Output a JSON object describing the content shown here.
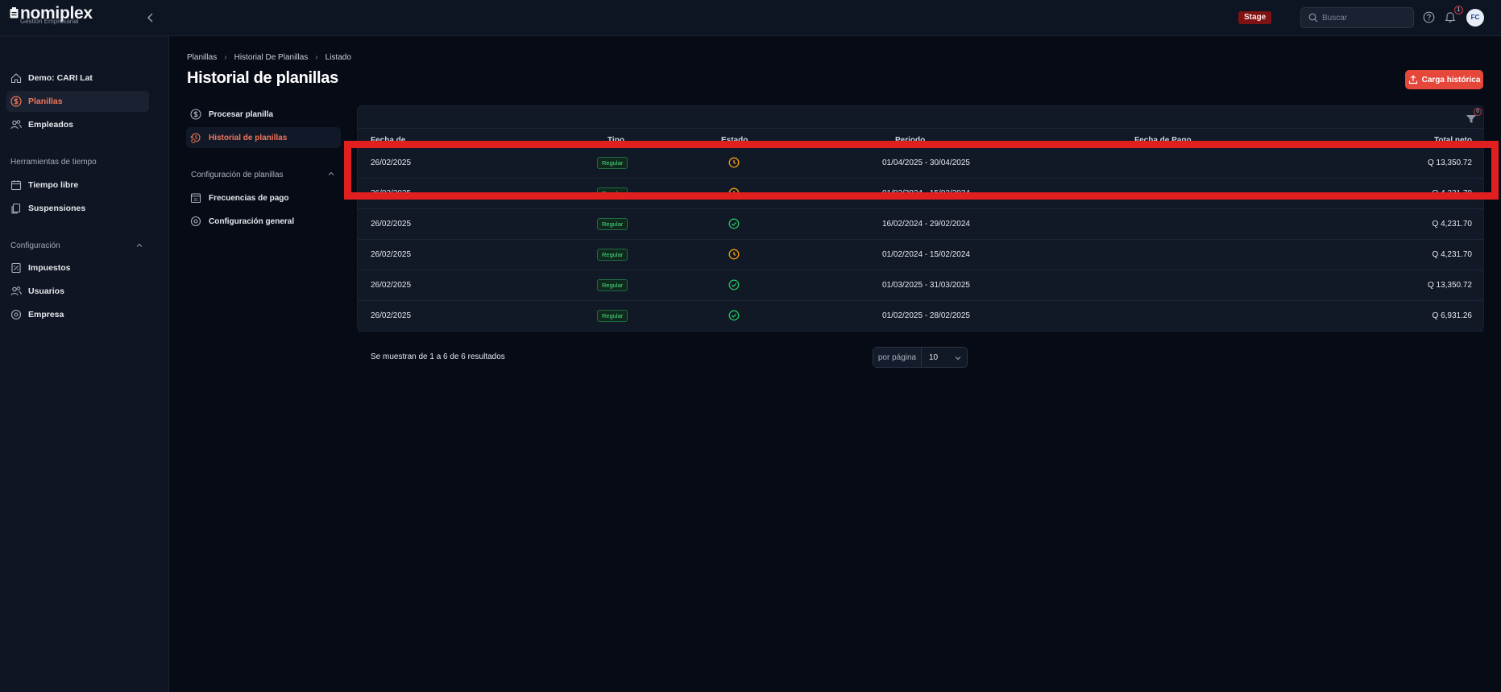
{
  "app": {
    "name": "nomiplex",
    "tagline": "Gestión Empresarial",
    "env_badge": "Stage",
    "user_initials": "FC",
    "notification_count": "1"
  },
  "search": {
    "placeholder": "Buscar"
  },
  "sidebar": {
    "top_items": [
      {
        "label": "Demo: CARI Lat",
        "icon": "home-icon",
        "active": false
      },
      {
        "label": "Planillas",
        "icon": "dollar-circle-icon",
        "active": true
      },
      {
        "label": "Empleados",
        "icon": "users-icon",
        "active": false
      }
    ],
    "sections": [
      {
        "title": "Herramientas de tiempo",
        "items": [
          {
            "label": "Tiempo libre",
            "icon": "calendar-icon"
          },
          {
            "label": "Suspensiones",
            "icon": "document-copy-icon"
          }
        ]
      },
      {
        "title": "Configuración",
        "items": [
          {
            "label": "Impuestos",
            "icon": "tax-icon"
          },
          {
            "label": "Usuarios",
            "icon": "users-icon"
          },
          {
            "label": "Empresa",
            "icon": "gear-icon"
          }
        ]
      }
    ]
  },
  "breadcrumb": [
    "Planillas",
    "Historial De Planillas",
    "Listado"
  ],
  "page_title": "Historial de planillas",
  "primary_action": "Carga histórica",
  "subnav": {
    "items": [
      {
        "label": "Procesar planilla",
        "active": false
      },
      {
        "label": "Historial de planillas",
        "active": true
      }
    ],
    "section_title": "Configuración de planillas",
    "section_items": [
      {
        "label": "Frecuencias de pago"
      },
      {
        "label": "Configuración general"
      }
    ]
  },
  "table": {
    "filter_count": "0",
    "headers": [
      "Fecha de ...",
      "Tipo",
      "Estado",
      "Periodo",
      "Fecha de Pago",
      "Total neto"
    ],
    "rows": [
      {
        "fecha": "26/02/2025",
        "tipo": "Regular",
        "estado": "pending",
        "periodo": "01/04/2025 - 30/04/2025",
        "total": "Q 13,350.72"
      },
      {
        "fecha": "26/02/2025",
        "tipo": "Regular",
        "estado": "pending",
        "periodo": "01/03/2024 - 15/03/2024",
        "total": "Q 4,231.70"
      },
      {
        "fecha": "26/02/2025",
        "tipo": "Regular",
        "estado": "done",
        "periodo": "16/02/2024 - 29/02/2024",
        "total": "Q 4,231.70"
      },
      {
        "fecha": "26/02/2025",
        "tipo": "Regular",
        "estado": "pending",
        "periodo": "01/02/2024 - 15/02/2024",
        "total": "Q 4,231.70"
      },
      {
        "fecha": "26/02/2025",
        "tipo": "Regular",
        "estado": "done",
        "periodo": "01/03/2025 - 31/03/2025",
        "total": "Q 13,350.72"
      },
      {
        "fecha": "26/02/2025",
        "tipo": "Regular",
        "estado": "done",
        "periodo": "01/02/2025 - 28/02/2025",
        "total": "Q 6,931.26"
      }
    ],
    "results_text": "Se muestran de 1 a 6 de 6 resultados",
    "per_page_label": "por página",
    "per_page_value": "10"
  },
  "colors": {
    "accent": "#e5483b",
    "active_text": "#f2765a",
    "success": "#22c55e",
    "pending": "#f59e0b",
    "highlight": "#e21f1f"
  }
}
